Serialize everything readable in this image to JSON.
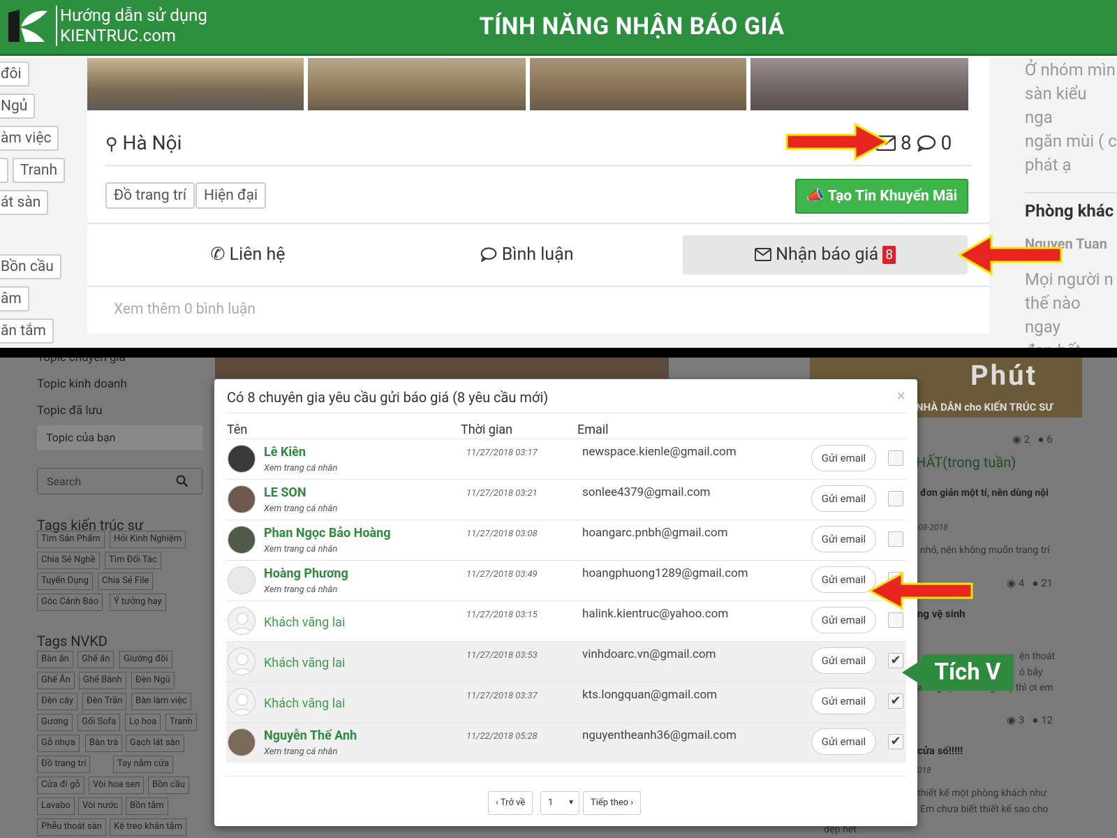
{
  "banner": {
    "logo_line1": "Hướng dẫn sử dụng",
    "logo_line2": "KIENTRUC.com",
    "title": "TÍNH NĂNG NHẬN BÁO GIÁ",
    "color": "#2b8f3e"
  },
  "left_tags_top": [
    "đôi",
    "Ngủ",
    "àm việc",
    "Tranh",
    "át sàn",
    "Bồn cầu",
    "âm",
    "ăn tắm"
  ],
  "post_card": {
    "location": "Hà Nội",
    "mail_count": "8",
    "comment_count": "0",
    "tags": [
      "Đồ trang trí",
      "Hiện đại"
    ],
    "promo_button": "Tạo Tin Khuyến Mãi",
    "actions": {
      "contact": "Liên hệ",
      "comment": "Bình luận",
      "quote": "Nhận báo giá",
      "quote_badge": "8"
    },
    "see_more": "Xem thêm 0 bình luận"
  },
  "right_column_top": {
    "text1": "Ở nhóm mìn",
    "text2": "sàn kiểu nga",
    "text3": "ngăn mùi ( c",
    "text4": "phát ạ",
    "heading": "Phòng khác",
    "author": "Nguyen Tuan",
    "text5": "Mọi người n",
    "text6": "thế nào ngay",
    "text7": "đẹp hết."
  },
  "sidebar": {
    "links": [
      "Topic chuyên gia",
      "Topic kinh doanh",
      "Topic đã lưu"
    ],
    "your_topic": "Topic của bạn",
    "search_placeholder": "Search",
    "tags_architect_title": "Tags kiến trúc sư",
    "tags_architect": [
      "Tìm Sản Phẩm",
      "Hỏi Kinh Nghiệm",
      "Chia Sẻ Nghề",
      "Tìm Đối Tác",
      "Tuyển Dụng",
      "Chia Sẻ File",
      "Góc Cảnh Báo",
      "Ý tưởng hay"
    ],
    "tags_nvkd_title": "Tags NVKD",
    "tags_nvkd": [
      "Bàn ăn",
      "Ghế ăn",
      "Giường đôi",
      "Ghế Ăn",
      "Ghế Bành",
      "Đèn Ngủ",
      "Đèn cây",
      "Đèn Trần",
      "Bàn làm việc",
      "Gương",
      "Gối Sofa",
      "Lọ hoa",
      "Tranh",
      "Gỗ nhựa",
      "Bàn trà",
      "Gạch lát sàn",
      "Đồ trang trí",
      "Tay nắm cửa",
      "Cửa đi gỗ",
      "Vòi hoa sen",
      "Bồn cầu",
      "Lavabo",
      "Vòi nước",
      "Bồn tắm",
      "Phễu thoát sàn",
      "Kệ treo khăn tắm"
    ]
  },
  "right_column_bottom": {
    "banner_text": "Phút",
    "banner_sub": "NHÀ DÂN cho KIẾN TRÚC SƯ",
    "stat1": "2",
    "stat1b": "6",
    "heading": "HẤT(trong tuần)",
    "line1": "đơn giản một tí, nên dùng nội",
    "date1": "-08-2018",
    "line2": "nhỏ, nên không muốn trang trí",
    "stat2": "4",
    "stat2b": "21",
    "line3": "ng vệ sinh",
    "line4": "ện thoát",
    "line5": "ó bẫy",
    "line6": "ao ngược thì càng tốt) thì ơi em",
    "stat3": "3",
    "stat3b": "12",
    "line7": "cửa số!!!!!",
    "date2": "018",
    "line8": "thiết kế một phòng khách như",
    "line9": "Em chưa biết thiết kế sao cho",
    "line10": "đẹp hết."
  },
  "modal": {
    "title": "Có 8 chuyên gia yêu cầu gửi báo giá (8 yêu cầu mới)",
    "close": "×",
    "headers": [
      "Tên",
      "Thời gian",
      "Email"
    ],
    "send_label": "Gửi email",
    "rows": [
      {
        "name": "Lê Kiên",
        "sub": "Xem trang cá nhân",
        "time": "11/27/2018 03:17",
        "email": "newspace.kienle@gmail.com",
        "checked": false,
        "guest": false
      },
      {
        "name": "LE SON",
        "sub": "Xem trang cá nhân",
        "time": "11/27/2018 03:21",
        "email": "sonlee4379@gmail.com",
        "checked": false,
        "guest": false
      },
      {
        "name": "Phan Ngọc Bảo Hoàng",
        "sub": "Xem trang cá nhân",
        "time": "11/27/2018 03:08",
        "email": "hoangarc.pnbh@gmail.com",
        "checked": false,
        "guest": false
      },
      {
        "name": "Hoàng Phương",
        "sub": "Xem trang cá nhân",
        "time": "11/27/2018 03:49",
        "email": "hoangphuong1289@gmail.com",
        "checked": false,
        "guest": false
      },
      {
        "name": "Khách vãng lai",
        "sub": "",
        "time": "11/27/2018 03:15",
        "email": "halink.kientruc@yahoo.com",
        "checked": false,
        "guest": true
      },
      {
        "name": "Khách vãng lai",
        "sub": "",
        "time": "11/27/2018 03:53",
        "email": "vinhdoarc.vn@gmail.com",
        "checked": true,
        "guest": true
      },
      {
        "name": "Khách vãng lai",
        "sub": "",
        "time": "11/27/2018 03:37",
        "email": "kts.longquan@gmail.com",
        "checked": true,
        "guest": true
      },
      {
        "name": "Nguyễn Thế Anh",
        "sub": "Xem trang cá nhân",
        "time": "11/22/2018 05:28",
        "email": "nguyentheanh36@gmail.com",
        "checked": true,
        "guest": false
      }
    ],
    "pagination": {
      "prev": "‹ Trở về",
      "page": "1",
      "next": "Tiếp theo ›"
    }
  },
  "callout": {
    "label": "Tích V",
    "color": "#2e8b3e"
  },
  "arrow_color": "#e8261f"
}
